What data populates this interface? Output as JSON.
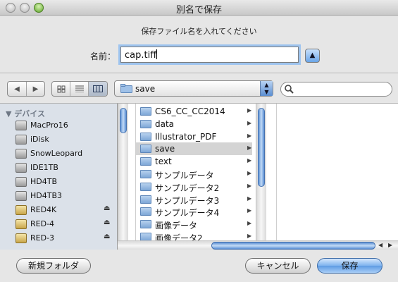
{
  "window": {
    "title": "別名で保存"
  },
  "panel": {
    "prompt": "保存ファイル名を入れてください",
    "name_label": "名前：",
    "name_value": "cap.tiff",
    "collapse_icon": "triangle-up-icon"
  },
  "toolbar": {
    "back": "◀",
    "forward": "▶",
    "view_modes": [
      "icon-view-icon",
      "list-view-icon",
      "column-view-icon"
    ],
    "active_view": "column-view-icon",
    "location": "save",
    "search_value": ""
  },
  "sidebar": {
    "header": "▼ デバイス",
    "items": [
      {
        "label": "MacPro16",
        "icon": "drive-icon",
        "eject": false
      },
      {
        "label": "iDisk",
        "icon": "idisk-icon",
        "eject": false
      },
      {
        "label": "SnowLeopard",
        "icon": "drive-icon",
        "eject": false
      },
      {
        "label": "IDE1TB",
        "icon": "drive-icon",
        "eject": false
      },
      {
        "label": "HD4TB",
        "icon": "drive-icon",
        "eject": false
      },
      {
        "label": "HD4TB3",
        "icon": "drive-icon",
        "eject": false
      },
      {
        "label": "RED4K",
        "icon": "external-drive-icon",
        "eject": true
      },
      {
        "label": "RED-4",
        "icon": "external-drive-icon",
        "eject": true
      },
      {
        "label": "RED-3",
        "icon": "external-drive-icon",
        "eject": true
      }
    ],
    "eject_glyph": "⏏"
  },
  "browser": {
    "folders": [
      {
        "label": "CS6_CC_CC2014",
        "selected": false
      },
      {
        "label": "data",
        "selected": false
      },
      {
        "label": "Illustrator_PDF",
        "selected": false
      },
      {
        "label": "save",
        "selected": true
      },
      {
        "label": "text",
        "selected": false
      },
      {
        "label": "サンプルデータ",
        "selected": false
      },
      {
        "label": "サンプルデータ2",
        "selected": false
      },
      {
        "label": "サンプルデータ3",
        "selected": false
      },
      {
        "label": "サンプルデータ4",
        "selected": false
      },
      {
        "label": "画像データ",
        "selected": false
      },
      {
        "label": "画像データ2",
        "selected": false
      }
    ],
    "arrow_glyph": "▶"
  },
  "buttons": {
    "new_folder": "新規フォルダ",
    "cancel": "キャンセル",
    "save": "保存"
  },
  "colors": {
    "accent": "#5e9be4",
    "selection": "#d4d4d4",
    "sidebar_bg": "#dbe1e9"
  }
}
